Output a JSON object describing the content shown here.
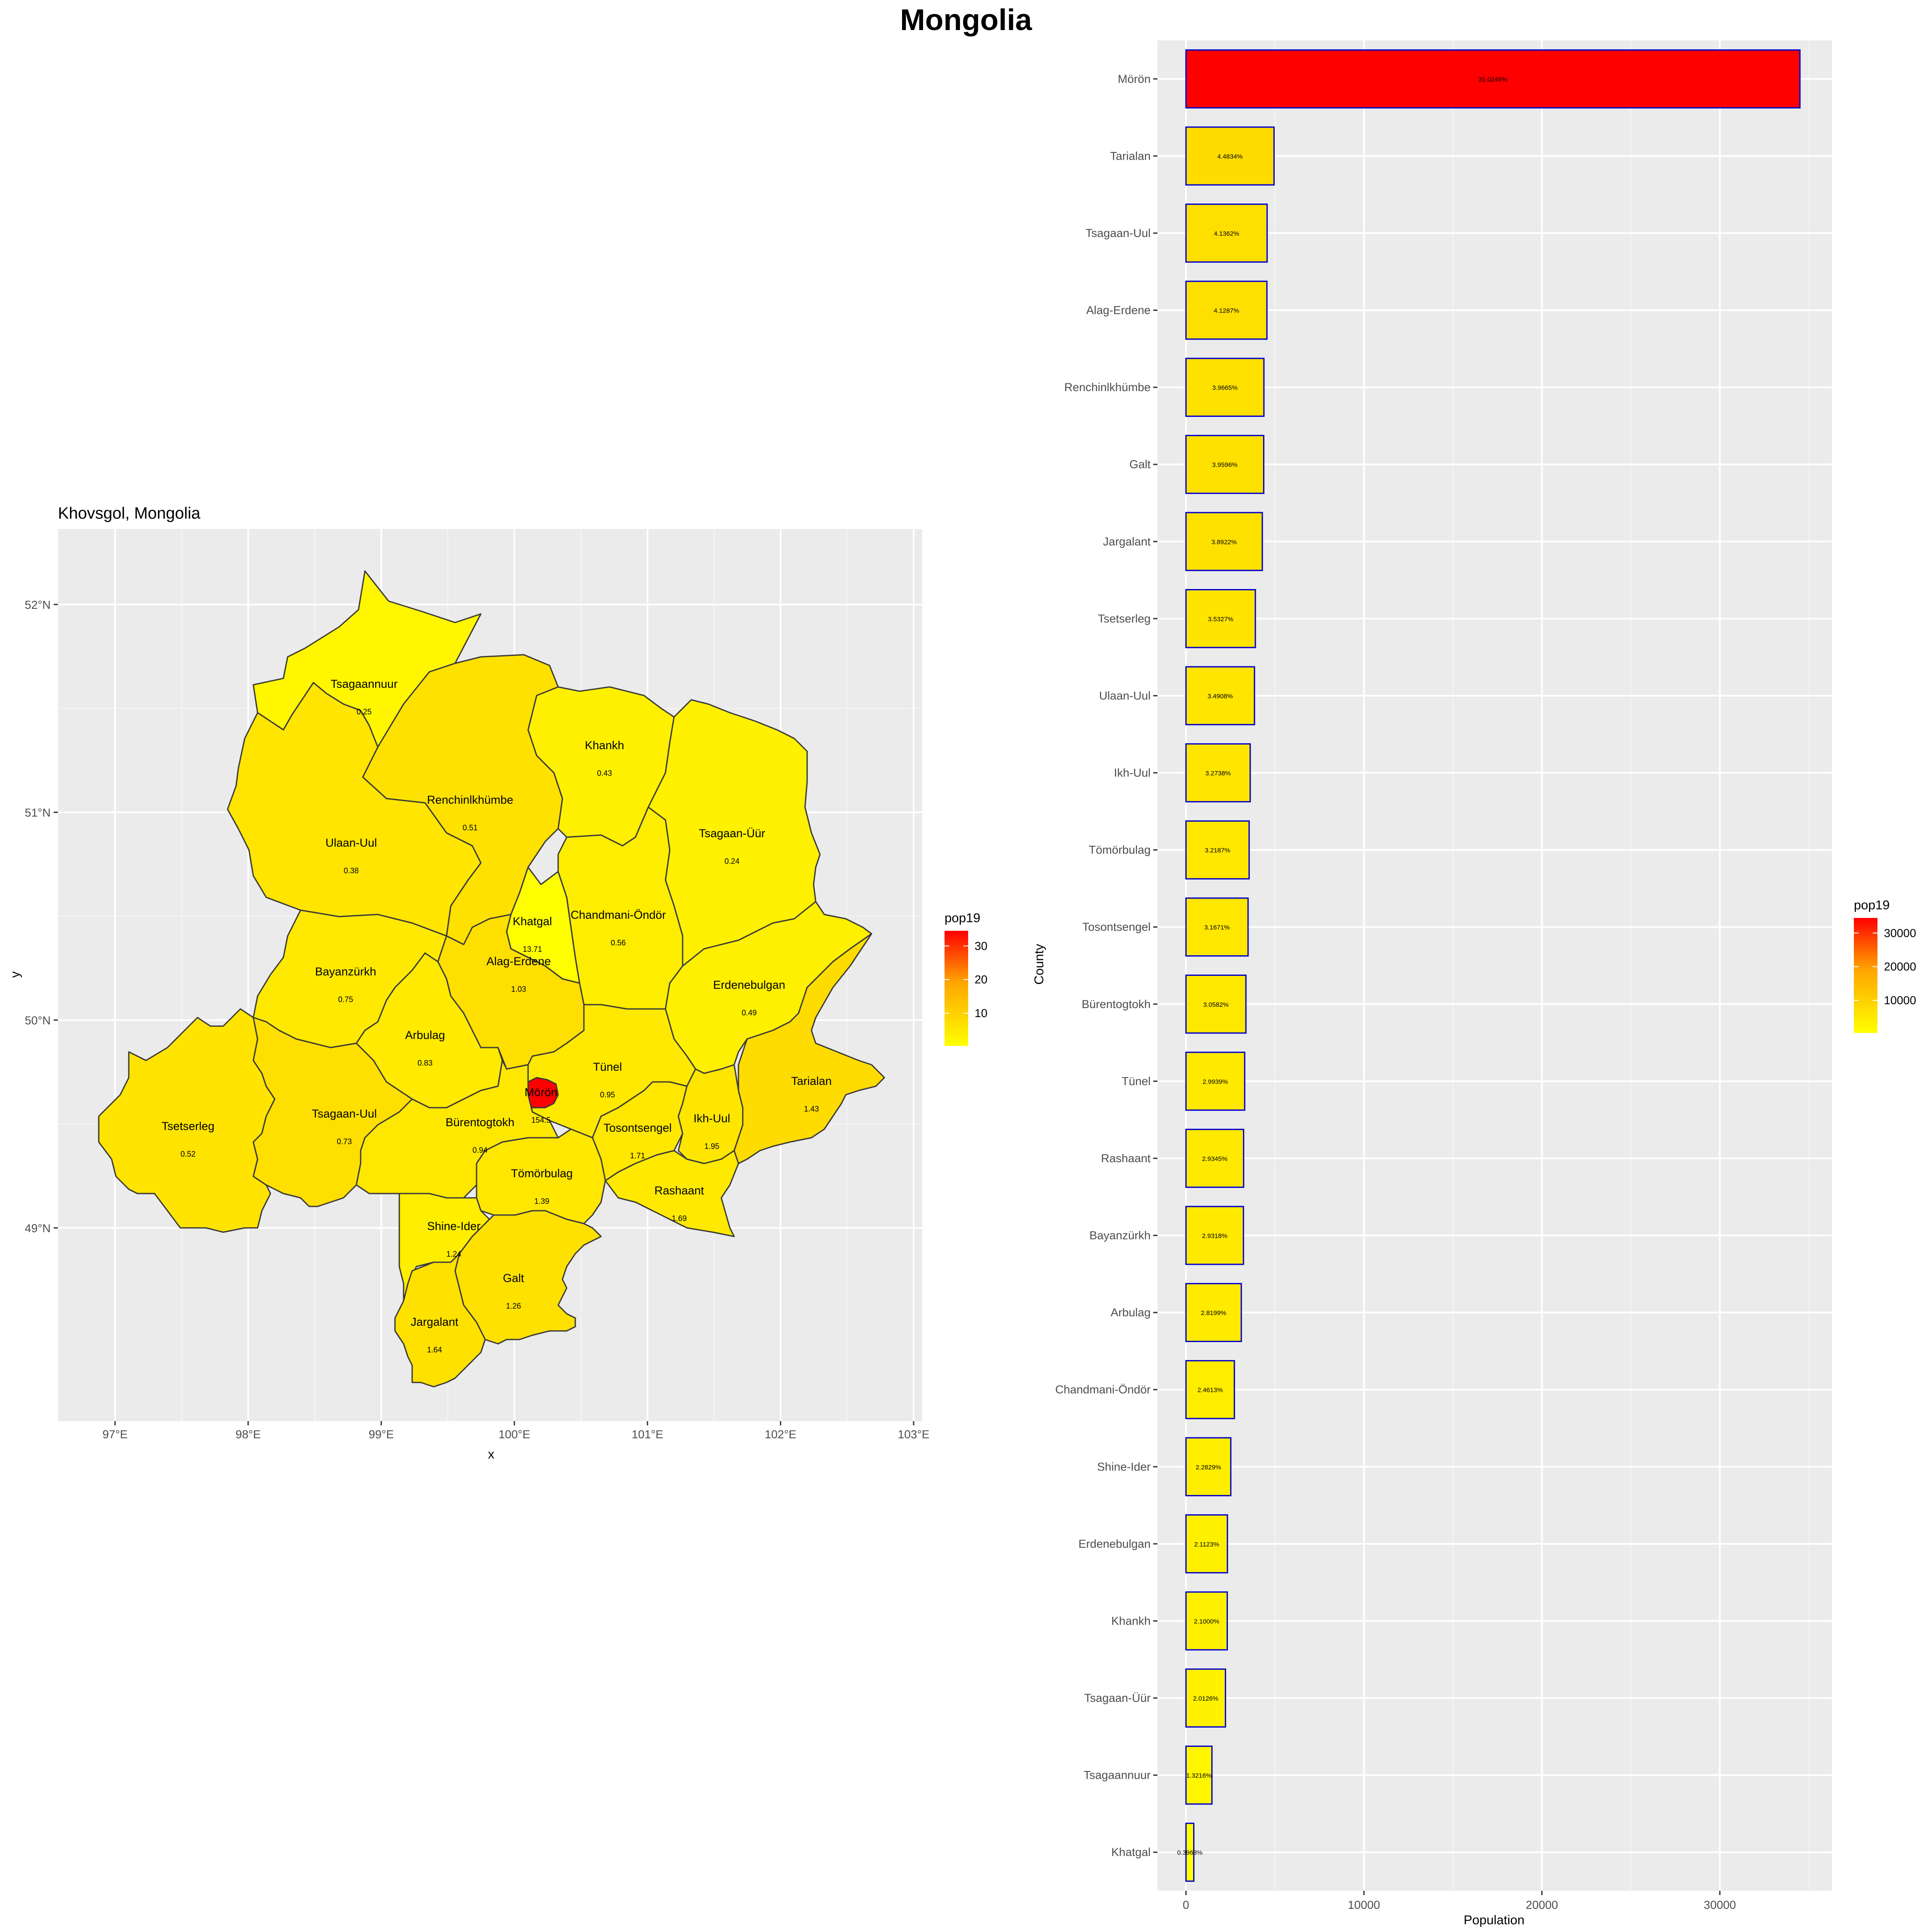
{
  "title": "Mongolia",
  "colors": {
    "panel_bg": "#EBEBEB",
    "grid": "#FFFFFF",
    "low": "#FFFF00",
    "high": "#FF0000",
    "bar_border": "#0000CC",
    "border": "#3A3A3A"
  },
  "map": {
    "title": "Khovsgol, Mongolia",
    "xlabel": "x",
    "ylabel": "y",
    "x_ticks": [
      "97°E",
      "98°E",
      "99°E",
      "100°E",
      "101°E",
      "102°E",
      "103°E"
    ],
    "y_ticks": [
      "52°N",
      "51°N",
      "50°N",
      "49°N"
    ],
    "legend": {
      "title": "pop19",
      "breaks": [
        "30000",
        "20000",
        "10000"
      ]
    },
    "regions": [
      {
        "name": "Tsagaannuur",
        "value": "0.25"
      },
      {
        "name": "Khankh",
        "value": "0.43"
      },
      {
        "name": "Renchinlkhümbe",
        "value": "0.51"
      },
      {
        "name": "Ulaan-Uul",
        "value": "0.38"
      },
      {
        "name": "Tsagaan-Üür",
        "value": "0.24"
      },
      {
        "name": "Khatgal",
        "value": "13.71"
      },
      {
        "name": "Chandmani-Öndör",
        "value": "0.56"
      },
      {
        "name": "Alag-Erdene",
        "value": "1.03"
      },
      {
        "name": "Bayanzürkh",
        "value": "0.75"
      },
      {
        "name": "Erdenebulgan",
        "value": "0.49"
      },
      {
        "name": "Arbulag",
        "value": "0.83"
      },
      {
        "name": "Tünel",
        "value": "0.95"
      },
      {
        "name": "Tarialan",
        "value": "1.43"
      },
      {
        "name": "Mörön",
        "value": "154.5"
      },
      {
        "name": "Tsetserleg",
        "value": "0.52"
      },
      {
        "name": "Tsagaan-Uul",
        "value": "0.73"
      },
      {
        "name": "Bürentogtokh",
        "value": "0.94"
      },
      {
        "name": "Tosontsengel",
        "value": "1.71"
      },
      {
        "name": "Ikh-Uul",
        "value": "1.95"
      },
      {
        "name": "Tömörbulag",
        "value": "1.39"
      },
      {
        "name": "Rashaant",
        "value": "1.69"
      },
      {
        "name": "Shine-Ider",
        "value": "1.24"
      },
      {
        "name": "Galt",
        "value": "1.26"
      },
      {
        "name": "Jargalant",
        "value": "1.64"
      }
    ]
  },
  "bar": {
    "xlabel": "Population",
    "ylabel": "County",
    "x_ticks": [
      "0",
      "10000",
      "20000",
      "30000"
    ],
    "legend": {
      "title": "pop19",
      "breaks": [
        "30000",
        "20000",
        "10000"
      ]
    }
  },
  "chart_data": [
    {
      "type": "bar",
      "orientation": "horizontal",
      "categories": [
        "Mörön",
        "Tarialan",
        "Tsagaan-Uul",
        "Alag-Erdene",
        "Renchinlkhümbe",
        "Galt",
        "Jargalant",
        "Tsetserleg",
        "Ulaan-Uul",
        "Ikh-Uul",
        "Tömörbulag",
        "Tosontsengel",
        "Bürentogtokh",
        "Tünel",
        "Rashaant",
        "Bayanzürkh",
        "Arbulag",
        "Chandmani-Öndör",
        "Shine-Ider",
        "Erdenebulgan",
        "Khankh",
        "Tsagaan-Üür",
        "Tsagaannuur",
        "Khatgal"
      ],
      "values": [
        34500,
        4950,
        4560,
        4550,
        4380,
        4370,
        4290,
        3900,
        3850,
        3610,
        3550,
        3490,
        3370,
        3300,
        3240,
        3230,
        3110,
        2720,
        2520,
        2330,
        2320,
        2220,
        1460,
        440
      ],
      "labels": [
        "31.0245%",
        "4.4834%",
        "4.1362%",
        "4.1287%",
        "3.9665%",
        "3.9596%",
        "3.8922%",
        "3.5327%",
        "3.4908%",
        "3.2738%",
        "3.2187%",
        "3.1671%",
        "3.0582%",
        "2.9939%",
        "2.9345%",
        "2.9318%",
        "2.8199%",
        "2.4613%",
        "2.2829%",
        "2.1123%",
        "2.1000%",
        "2.0126%",
        "1.3216%",
        "0.3968%"
      ],
      "xlim": [
        -1600,
        36300
      ],
      "xlabel": "Population",
      "ylabel": "County",
      "legend": "right",
      "grid": true
    }
  ]
}
